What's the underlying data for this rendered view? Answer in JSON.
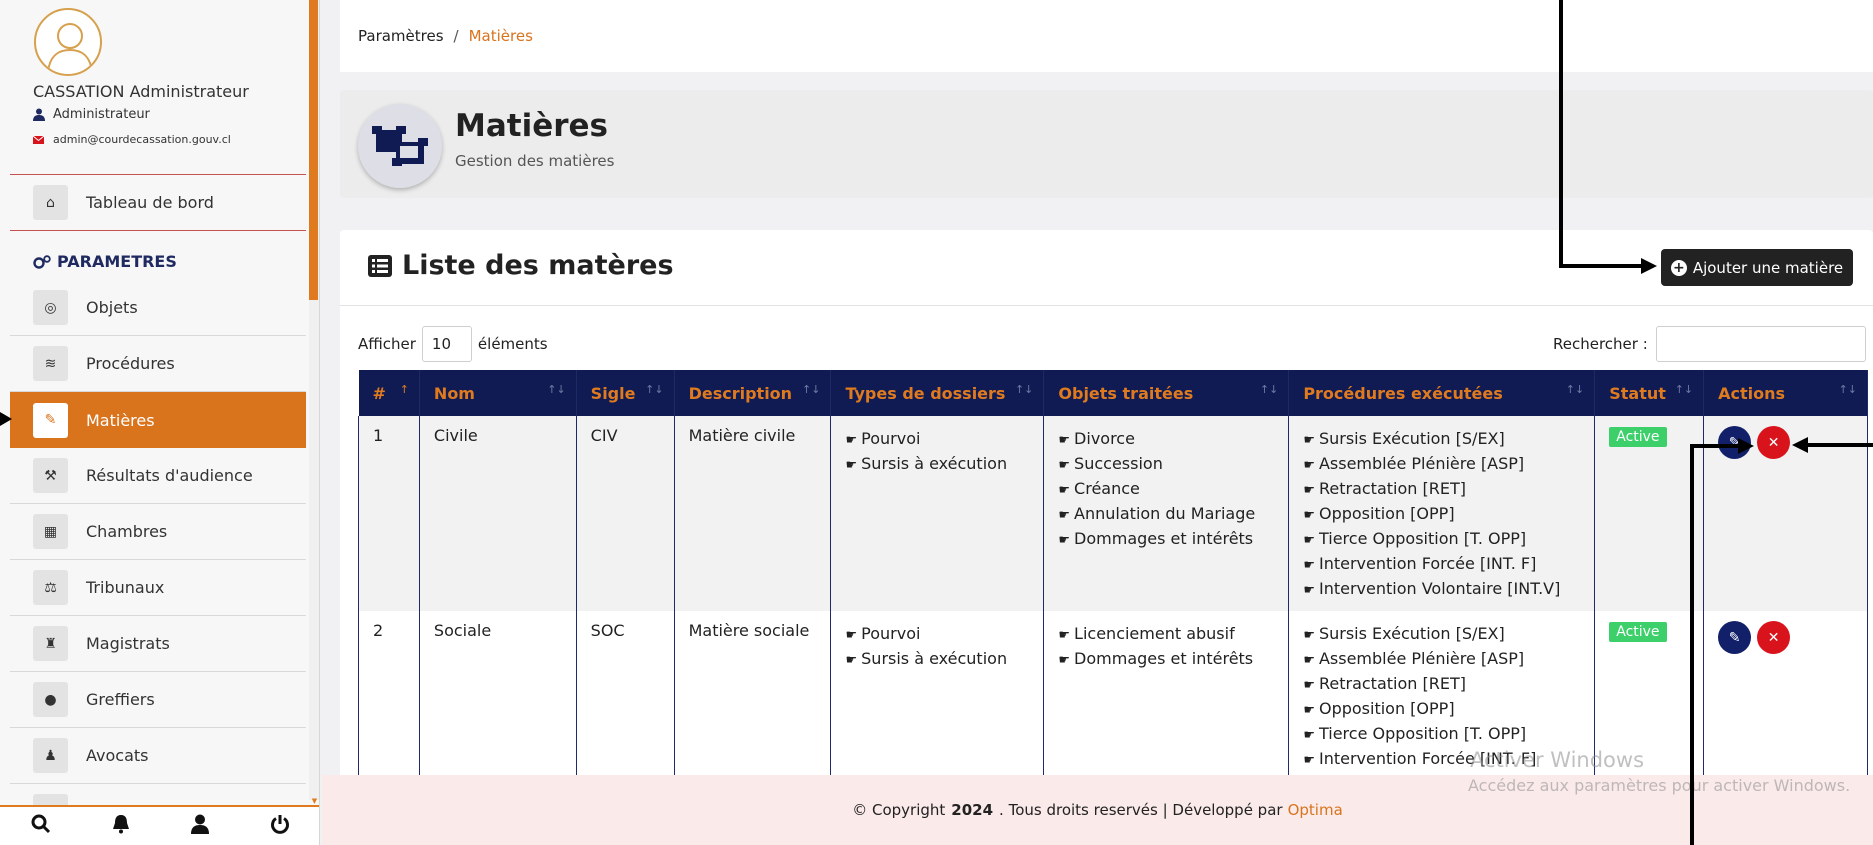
{
  "user": {
    "name": "CASSATION Administrateur",
    "role": "Administrateur",
    "email": "admin@courdecassation.gouv.cl"
  },
  "sidebar": {
    "dashboard_label": "Tableau de bord",
    "section_label": "PARAMETRES",
    "items": [
      {
        "label": "Objets",
        "icon": "target-icon"
      },
      {
        "label": "Procédures",
        "icon": "layers-icon"
      },
      {
        "label": "Matières",
        "icon": "subject-icon"
      },
      {
        "label": "Résultats d'audience",
        "icon": "gavel-icon"
      },
      {
        "label": "Chambres",
        "icon": "building-icon"
      },
      {
        "label": "Tribunaux",
        "icon": "scale-icon"
      },
      {
        "label": "Magistrats",
        "icon": "judge-icon"
      },
      {
        "label": "Greffiers",
        "icon": "user-icon"
      },
      {
        "label": "Avocats",
        "icon": "lawyer-icon"
      }
    ]
  },
  "breadcrumb": {
    "parent": "Paramètres",
    "separator": "/",
    "current": "Matières"
  },
  "header": {
    "title": "Matières",
    "subtitle": "Gestion des matières"
  },
  "list": {
    "title": "Liste des matères",
    "add_button": "Ajouter une matière",
    "show_label": "Afficher",
    "show_value": "10",
    "show_suffix": "éléments",
    "search_label": "Rechercher :"
  },
  "table": {
    "columns": [
      "#",
      "Nom",
      "Sigle",
      "Description",
      "Types de dossiers",
      "Objets traitées",
      "Procédures exécutées",
      "Statut",
      "Actions"
    ],
    "rows": [
      {
        "num": "1",
        "nom": "Civile",
        "sigle": "CIV",
        "description": "Matière civile",
        "types": [
          "Pourvoi",
          "Sursis à exécution"
        ],
        "objets": [
          "Divorce",
          "Succession",
          "Créance",
          "Annulation du Mariage",
          "Dommages et intérêts"
        ],
        "procedures": [
          "Sursis Exécution [S/EX]",
          "Assemblée Plénière [ASP]",
          "Retractation [RET]",
          "Opposition [OPP]",
          "Tierce Opposition [T. OPP]",
          "Intervention Forcée [INT. F]",
          "Intervention Volontaire [INT.V]"
        ],
        "statut": "Active"
      },
      {
        "num": "2",
        "nom": "Sociale",
        "sigle": "SOC",
        "description": "Matière sociale",
        "types": [
          "Pourvoi",
          "Sursis à exécution"
        ],
        "objets": [
          "Licenciement abusif",
          "Dommages et intérêts"
        ],
        "procedures": [
          "Sursis Exécution [S/EX]",
          "Assemblée Plénière [ASP]",
          "Retractation [RET]",
          "Opposition [OPP]",
          "Tierce Opposition [T. OPP]",
          "Intervention Forcée [INT. F]"
        ],
        "statut": "Active"
      }
    ]
  },
  "footer": {
    "prefix": "© Copyright",
    "year": "2024",
    "middle": ". Tous droits reservés | Développé par",
    "brand": "Optima"
  },
  "watermark": {
    "line1": "Activer Windows",
    "line2": "Accédez aux paramètres pour activer Windows."
  },
  "colors": {
    "accent": "#d9731c",
    "navy": "#0f1b52",
    "active_badge": "#3ccf6a",
    "delete": "#d9131c"
  }
}
